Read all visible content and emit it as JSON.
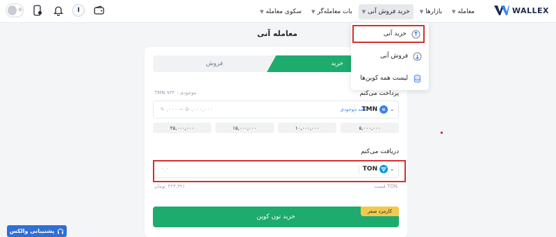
{
  "header": {
    "logo_text": "WALLEX",
    "nav": [
      {
        "label": "معامله",
        "dropdown": true
      },
      {
        "label": "بازارها",
        "dropdown": true
      },
      {
        "label": "خرید فروش آنی",
        "dropdown": true,
        "active": true
      },
      {
        "label": "بات معامله‌گر",
        "dropdown": true
      },
      {
        "label": "سکوی معامله",
        "dropdown": true
      }
    ],
    "avatar_letter": "I",
    "icons": [
      "theme-toggle-icon",
      "wallet-icon",
      "bell-icon",
      "phone-icon"
    ]
  },
  "dropdown_menu": {
    "items": [
      {
        "label": "خرید آنی",
        "icon": "instant-buy-icon",
        "highlighted": true
      },
      {
        "label": "فروش آنی",
        "icon": "instant-sell-icon"
      },
      {
        "label": "لیست همه کوین‌ها",
        "icon": "coin-list-icon"
      }
    ]
  },
  "page": {
    "title": "معامله آنی"
  },
  "trade": {
    "tab_buy": "خرید",
    "tab_sell": "فروش",
    "pay_label": "پرداخت می‌کنم",
    "balance_label": "موجودی :",
    "balance_value": "۹۳۴ TMN",
    "pay_currency": "TMN",
    "pay_all_balance": "همه موجودی",
    "pay_placeholder": "۹۰,۰۰۰ ~ ۵۰,۰۰۰,۰۰۰",
    "presets": [
      "۵,۰۰۰,۰۰۰",
      "۱۰,۰۰۰,۰۰۰",
      "۱۵,۰۰۰,۰۰۰",
      "۲۵,۰۰۰,۰۰۰"
    ],
    "receive_label": "دریافت می‌کنم",
    "receive_currency": "TON",
    "receive_placeholder": "۰.۰",
    "price_label": "قیمت TON",
    "price_value": "۳۲۳,۳۲۱",
    "price_unit": "تومان",
    "fee_badge": "کارمزد صفر",
    "submit_label": "خرید تون کوین"
  },
  "support": {
    "label": "پشتیبانی والکس"
  },
  "colors": {
    "accent_green": "#1dab6e",
    "highlight_red": "#d32f2f",
    "brand_navy": "#1c2a4d",
    "support_blue": "#2f6fd6",
    "fee_yellow": "#f2c94c"
  }
}
